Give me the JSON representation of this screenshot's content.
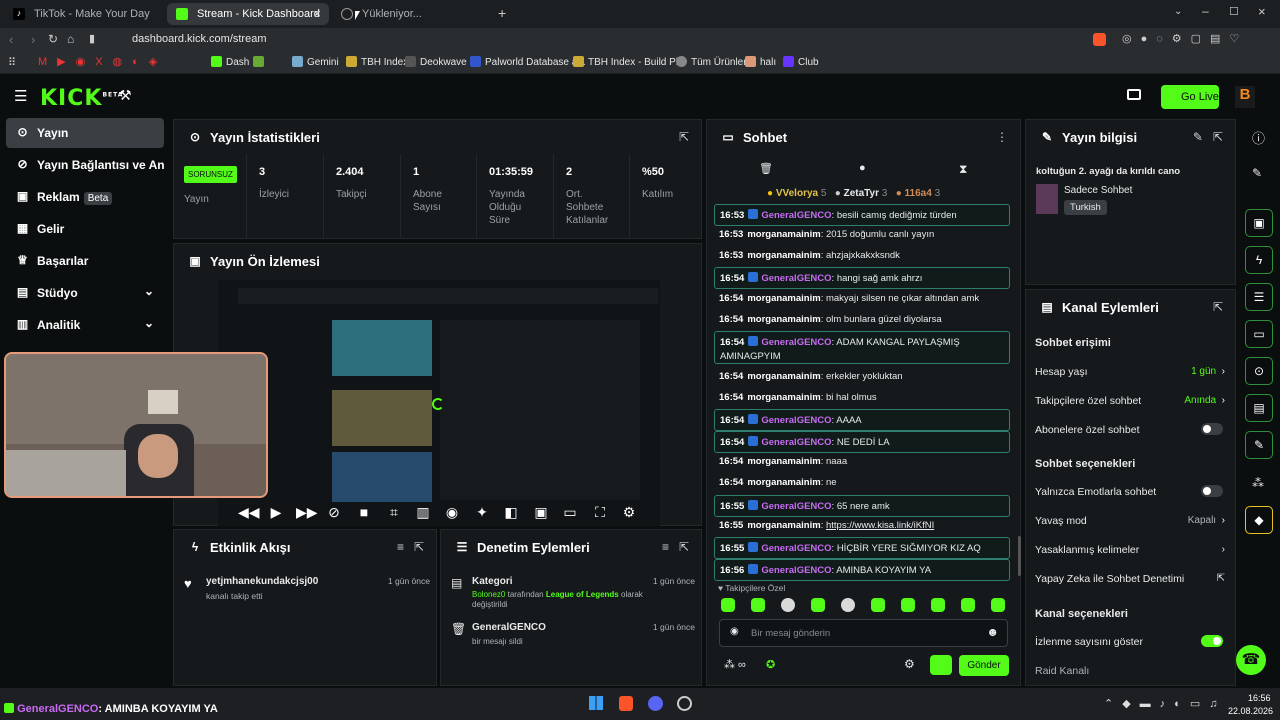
{
  "browser": {
    "tabs": [
      {
        "label": "TikTok - Make Your Day"
      },
      {
        "label": "Stream - Kick Dashboard"
      },
      {
        "label": "Yükleniyor..."
      }
    ],
    "url": "dashboard.kick.com/stream",
    "bookmarks": [
      "Dash",
      "Gemini",
      "TBH Index",
      "Deokwave",
      "Palworld Database a...",
      "TBH Index - Build Pl...",
      "Tüm Ürünler",
      "halı",
      "Club"
    ]
  },
  "header": {
    "logo": "KICK",
    "logo_tag": "BETA",
    "go_live": "Go Live"
  },
  "sidebar": {
    "items": [
      {
        "label": "Yayın",
        "icon": "broadcast-icon"
      },
      {
        "label": "Yayın Bağlantısı ve Anahtar",
        "icon": "link-icon"
      },
      {
        "label": "Reklam",
        "badge": "Beta",
        "icon": "ad-icon"
      },
      {
        "label": "Gelir",
        "icon": "revenue-icon"
      },
      {
        "label": "Başarılar",
        "icon": "trophy-icon"
      },
      {
        "label": "Stüdyo",
        "icon": "studio-icon"
      },
      {
        "label": "Analitik",
        "icon": "analytics-icon"
      }
    ]
  },
  "stats": {
    "title": "Yayın İstatistikleri",
    "items": [
      {
        "value": "SORUNSUZ",
        "label": "Yayın"
      },
      {
        "value": "3",
        "label": "İzleyici"
      },
      {
        "value": "2.404",
        "label": "Takipçi"
      },
      {
        "value": "1",
        "label": "Abone Sayısı"
      },
      {
        "value": "01:35:59",
        "label": "Yayında Olduğu Süre"
      },
      {
        "value": "2",
        "label": "Ort. Sohbete Katılanlar"
      },
      {
        "value": "%50",
        "label": "Katılım"
      }
    ]
  },
  "preview": {
    "title": "Yayın Ön İzlemesi"
  },
  "activity": {
    "title": "Etkinlik Akışı",
    "items": [
      {
        "user": "yetjmhanekundakcjsj00",
        "text": "kanalı takip etti",
        "time": "1 gün önce"
      }
    ]
  },
  "moderation": {
    "title": "Denetim Eylemleri",
    "items": [
      {
        "title": "Kategori",
        "user": "Bolonez0",
        "mid": "tarafından",
        "game": "League of Legends",
        "end": "olarak değiştirildi",
        "time": "1 gün önce"
      },
      {
        "title": "GeneralGENCO",
        "text": "bir mesajı sildi",
        "time": "1 gün önce"
      }
    ]
  },
  "chat": {
    "title": "Sohbet",
    "top_users": [
      {
        "name": "VVelorya",
        "count": "5"
      },
      {
        "name": "ZetaTyr",
        "count": "3"
      },
      {
        "name": "116a4",
        "count": "3"
      }
    ],
    "messages": [
      {
        "time": "16:53",
        "user": "GeneralGENCO",
        "text": "besili camış dediğmiz türden",
        "hl": true
      },
      {
        "time": "16:53",
        "user": "morganamainim",
        "text": "2015 doğumlu canlı yayın",
        "hl": false
      },
      {
        "time": "16:53",
        "user": "morganamainim",
        "text": "ahzjajxkakxksndk",
        "hl": false
      },
      {
        "time": "16:54",
        "user": "GeneralGENCO",
        "text": "hangi sağ amk ahrzı",
        "hl": true
      },
      {
        "time": "16:54",
        "user": "morganamainim",
        "text": "makyajı silsen ne çıkar altından amk",
        "hl": false
      },
      {
        "time": "16:54",
        "user": "morganamainim",
        "text": "olm bunlara güzel diyolarsa",
        "hl": false
      },
      {
        "time": "16:54",
        "user": "GeneralGENCO",
        "text": "ADAM KANGAL PAYLAŞMIŞ AMINAGPYIM",
        "hl": true
      },
      {
        "time": "16:54",
        "user": "morganamainim",
        "text": "erkekler yokluktan",
        "hl": false
      },
      {
        "time": "16:54",
        "user": "morganamainim",
        "text": "bi hal olmus",
        "hl": false
      },
      {
        "time": "16:54",
        "user": "GeneralGENCO",
        "text": "AAAA",
        "hl": true
      },
      {
        "time": "16:54",
        "user": "GeneralGENCO",
        "text": "NE DEDİ LA",
        "hl": true
      },
      {
        "time": "16:54",
        "user": "morganamainim",
        "text": "naaa",
        "hl": false
      },
      {
        "time": "16:54",
        "user": "morganamainim",
        "text": "ne",
        "hl": false
      },
      {
        "time": "16:55",
        "user": "GeneralGENCO",
        "text": "65 nere amk",
        "hl": true
      },
      {
        "time": "16:55",
        "user": "morganamainim",
        "text": "https://www.kisa.link/iKfNI",
        "hl": false
      },
      {
        "time": "16:55",
        "user": "GeneralGENCO",
        "text": "HİÇBİR YERE SIĞMIYOR KIZ AQ",
        "hl": true
      },
      {
        "time": "16:56",
        "user": "GeneralGENCO",
        "text": "AMINBA KOYAYIM YA",
        "hl": true
      }
    ],
    "followers_only": "Takipçilere Özel",
    "placeholder": "Bir mesaj gönderin",
    "send": "Gönder"
  },
  "stream_info": {
    "title": "Yayın bilgisi",
    "stream_title": "koltuğun 2. ayağı da kırıldı cano",
    "category": "Sadece Sohbet",
    "language": "Turkish"
  },
  "channel_actions": {
    "title": "Kanal Eylemleri",
    "chat_access": "Sohbet erişimi",
    "account_age": {
      "label": "Hesap yaşı",
      "value": "1 gün"
    },
    "follower_chat": {
      "label": "Takipçilere özel sohbet",
      "value": "Anında"
    },
    "subscriber_chat": {
      "label": "Abonelere özel sohbet"
    },
    "chat_options": "Sohbet seçenekleri",
    "emote_only": {
      "label": "Yalnızca Emotlarla sohbet"
    },
    "slow_mode": {
      "label": "Yavaş mod",
      "value": "Kapalı"
    },
    "banned_words": {
      "label": "Yasaklanmış kelimeler"
    },
    "ai_mod": {
      "label": "Yapay Zeka ile Sohbet Denetimi"
    },
    "channel_options": "Kanal seçenekleri",
    "view_count": {
      "label": "İzlenme sayısını göster"
    },
    "raid": {
      "label": "Raid Kanalı"
    }
  },
  "overlay": {
    "user": "GeneralGENCO",
    "text": ": AMINBA KOYAYIM YA"
  },
  "taskbar": {
    "time": "16:56",
    "date": "22.08.2026"
  },
  "colors": {
    "accent": "#53fc18",
    "bg": "#0b0e0f",
    "panel": "#15191b"
  }
}
